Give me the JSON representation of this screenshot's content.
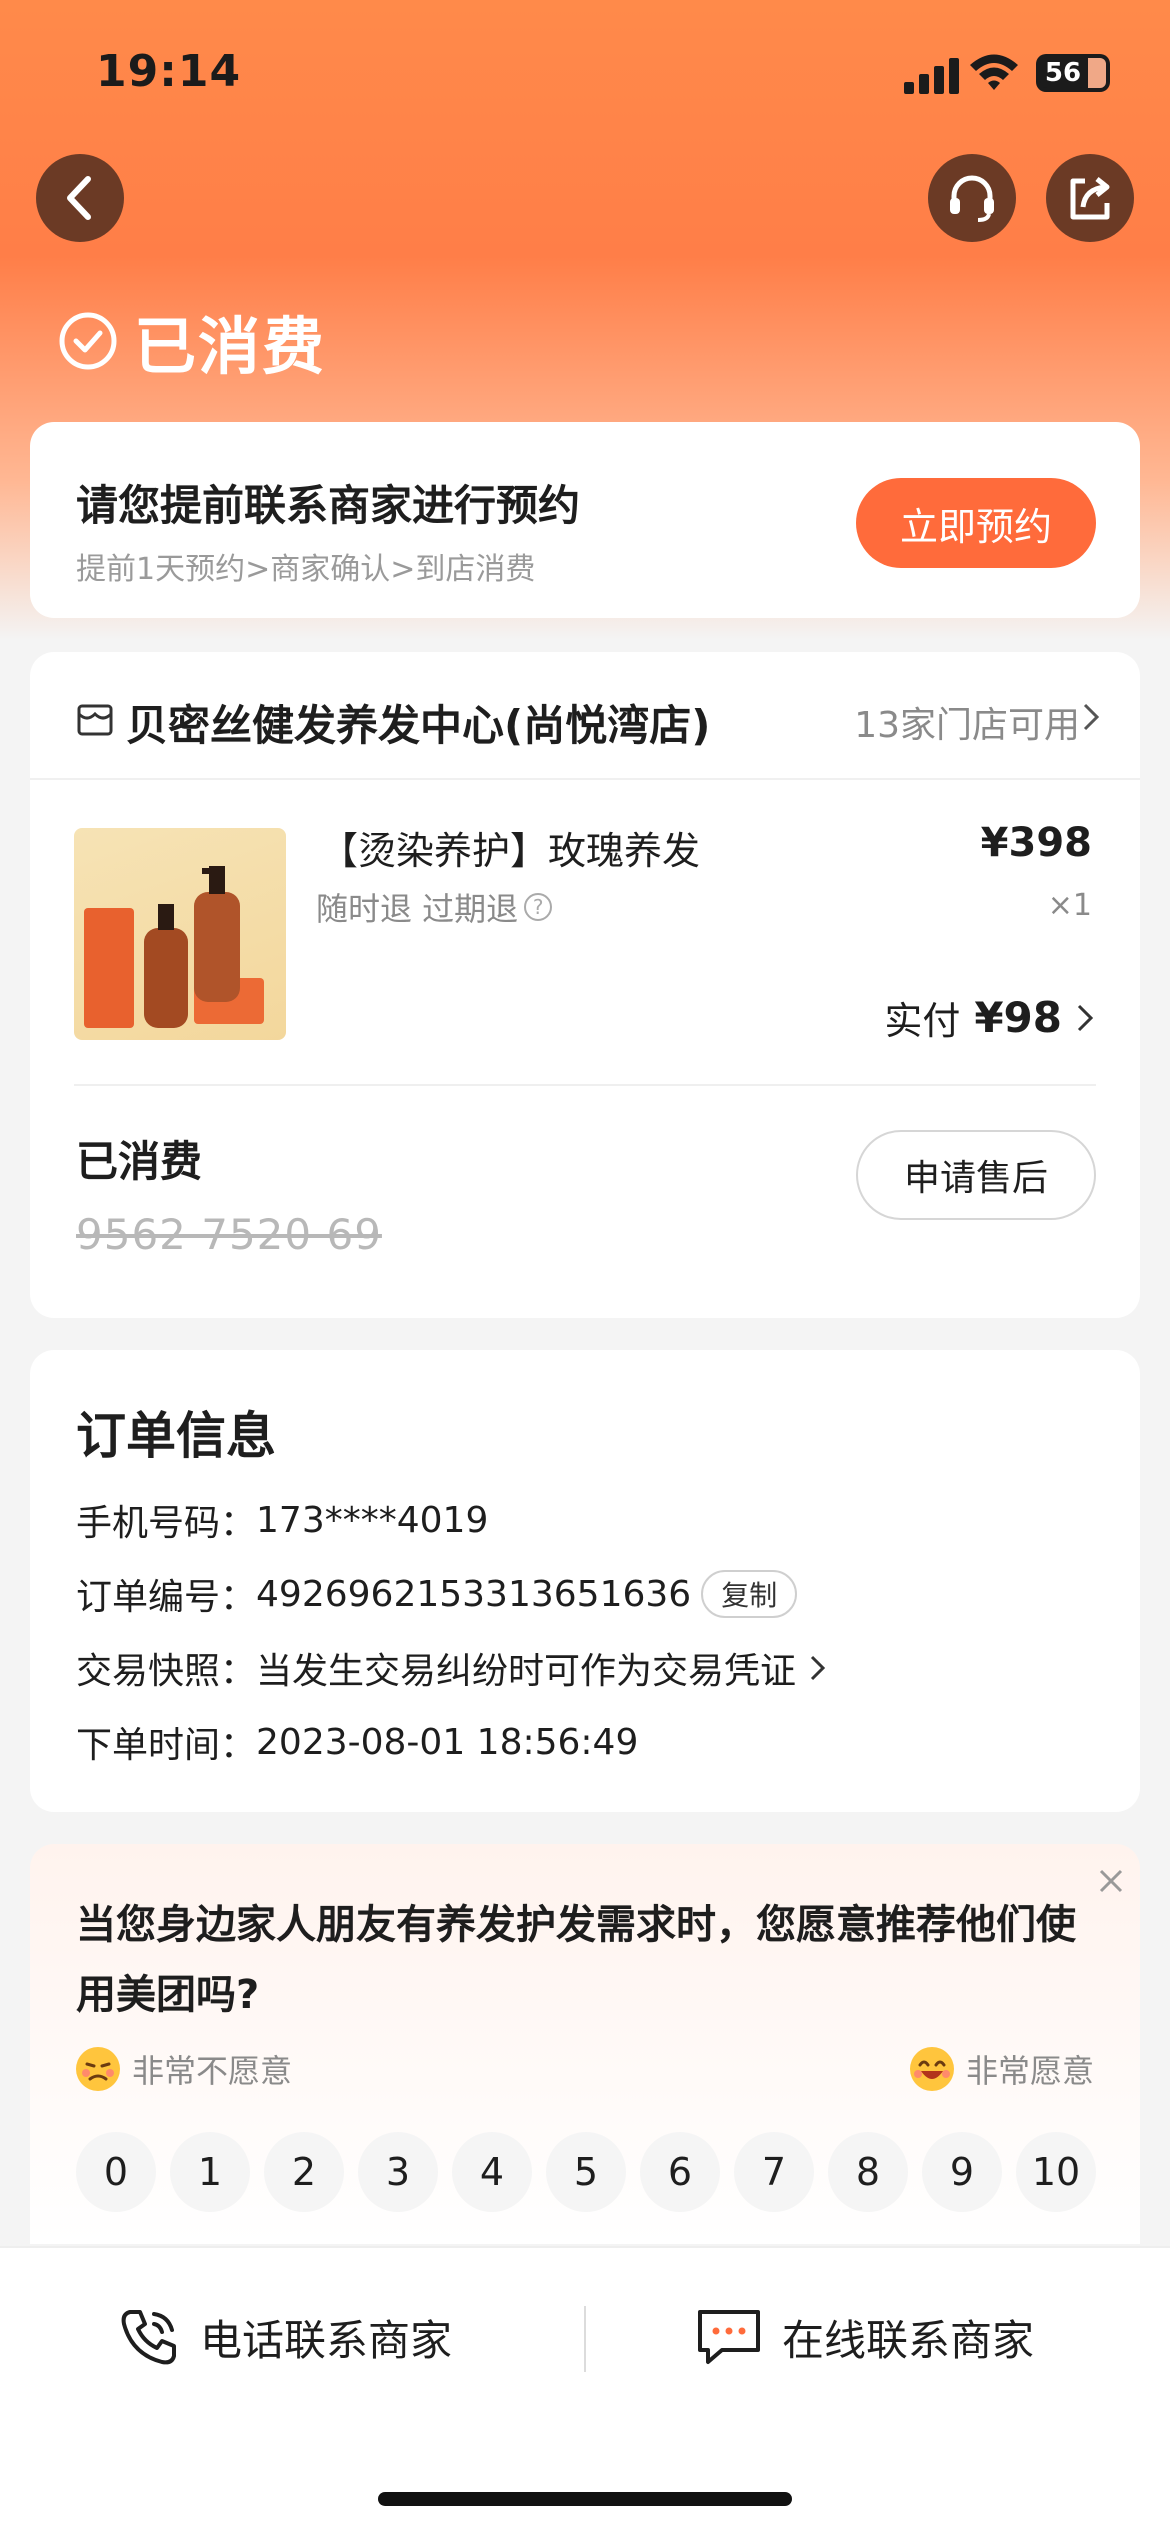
{
  "status_bar": {
    "time": "19:14",
    "battery": "56"
  },
  "header": {
    "status_text": "已消费"
  },
  "booking": {
    "title": "请您提前联系商家进行预约",
    "steps": "提前1天预约>商家确认>到店消费",
    "button_label": "立即预约"
  },
  "order": {
    "store_name": "贝密丝健发养发中心(尚悦湾店)",
    "store_count": "13家门店可用",
    "product_name": "【烫染养护】玫瑰养发",
    "policy": "随时退 过期退",
    "price": "¥398",
    "quantity": "×1",
    "paid_label": "实付",
    "paid_amount": "¥98",
    "consumed_label": "已消费",
    "voucher_code": "9562 7520 69",
    "after_sale_label": "申请售后"
  },
  "info": {
    "title": "订单信息",
    "phone_label": "手机号码：",
    "phone_value": "173****4019",
    "order_no_label": "订单编号：",
    "order_no_value": "4926962153313651636",
    "copy_label": "复制",
    "snapshot_label": "交易快照：",
    "snapshot_value": "当发生交易纠纷时可作为交易凭证",
    "time_label": "下单时间：",
    "time_value": "2023-08-01 18:56:49"
  },
  "survey": {
    "question": "当您身边家人朋友有养发护发需求时，您愿意推荐他们使用美团吗?",
    "low_label": "非常不愿意",
    "high_label": "非常愿意",
    "scores": [
      "0",
      "1",
      "2",
      "3",
      "4",
      "5",
      "6",
      "7",
      "8",
      "9",
      "10"
    ]
  },
  "bottom_bar": {
    "phone_label": "电话联系商家",
    "online_label": "在线联系商家"
  },
  "colors": {
    "accent": "#ff6b3b",
    "header": "#ff8a4a"
  }
}
